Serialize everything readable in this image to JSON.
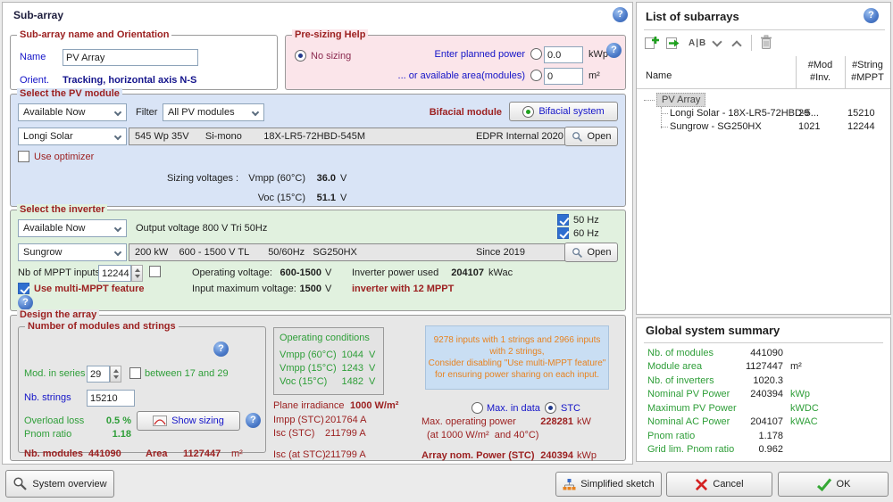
{
  "main": {
    "title": "Sub-array",
    "nameOrient": {
      "legend": "Sub-array name and Orientation",
      "nameLabel": "Name",
      "nameValue": "PV Array",
      "orientLabel": "Orient.",
      "orientValue": "Tracking, horizontal axis N-S"
    },
    "presizing": {
      "legend": "Pre-sizing Help",
      "noSizing": "No sizing",
      "plannedLabel": "Enter planned power",
      "plannedValue": "0.0",
      "plannedUnit": "kWp",
      "areaLabel": "... or available area(modules)",
      "areaValue": "0",
      "areaUnit": "m²"
    },
    "pv": {
      "legend": "Select the PV module",
      "availability": "Available Now",
      "filterLabel": "Filter",
      "filterValue": "All PV modules",
      "bifacialLabel": "Bifacial module",
      "bifacialButton": "Bifacial system",
      "manufacturer": "Longi Solar",
      "spec": "545 Wp 35V      Si-mono        18X-LR5-72HBD-545M",
      "source": "EDPR Internal 2020",
      "open": "Open",
      "useOptimizer": "Use optimizer",
      "sizingLabel": "Sizing voltages :",
      "vmppLabel": "Vmpp (60°C)",
      "vmppValue": "36.0",
      "vmppUnit": "V",
      "vocLabel": "Voc (15°C)",
      "vocValue": "51.1",
      "vocUnit": "V"
    },
    "inv": {
      "legend": "Select the inverter",
      "availability": "Available Now",
      "outputVoltage": "Output voltage 800 V Tri 50Hz",
      "hz50": "50 Hz",
      "hz60": "60 Hz",
      "manufacturer": "Sungrow",
      "spec": "200 kW    600 - 1500 V TL       50/60Hz   SG250HX",
      "since": "Since 2019",
      "open": "Open",
      "mpptLabel": "Nb of MPPT inputs",
      "mpptValue": "12244",
      "opVoltLabel": "Operating voltage:",
      "opVoltValue": "600-1500",
      "opVoltUnit": "V",
      "powerUsedLabel": "Inverter power used",
      "powerUsedValue": "204107",
      "powerUsedUnit": "kWac",
      "multiMppt": "Use multi-MPPT feature",
      "inputMaxLabel": "Input maximum voltage:",
      "inputMaxValue": "1500",
      "inputMaxUnit": "V",
      "mpptNote": "inverter with 12 MPPT"
    },
    "design": {
      "legend": "Design the array",
      "mods": {
        "legend": "Number of modules and strings",
        "modSeriesLabel": "Mod. in series",
        "modSeriesValue": "29",
        "betweenLabel": "between 17 and 29",
        "nbStringsLabel": "Nb. strings",
        "nbStringsValue": "15210",
        "overloadLabel": "Overload loss",
        "overloadValue": "0.5 %",
        "pnomLabel": "Pnom ratio",
        "pnomValue": "1.18",
        "showSizing": "Show sizing",
        "nbModulesLabel": "Nb. modules",
        "nbModulesValue": "441090",
        "areaLabel": "Area",
        "areaValue": "1127447",
        "areaUnit": "m²"
      },
      "operating": {
        "title": "Operating conditions",
        "rows": [
          {
            "label": "Vmpp (60°C)",
            "value": "1044",
            "unit": "V"
          },
          {
            "label": "Vmpp (15°C)",
            "value": "1243",
            "unit": "V"
          },
          {
            "label": "Voc (15°C)",
            "value": "1482",
            "unit": "V"
          }
        ]
      },
      "stc": {
        "planeLabel": "Plane irradiance",
        "planeValue": "1000 W/m²",
        "imppLabel": "Impp (STC)",
        "imppValue": "201764 A",
        "iscLabel": "Isc (STC)",
        "iscValue": "211799 A",
        "iscAtLabel": "Isc (at STC)",
        "iscAtValue": "211799 A"
      },
      "warning": [
        "9278 inputs with 1 strings and 2966 inputs",
        "with 2 strings,",
        "Consider disabling \"Use multi-MPPT feature\"",
        "for ensuring power sharing on each input."
      ],
      "maxInData": "Max. in data",
      "stcRadio": "STC",
      "maxPowerLabel": "Max. operating power",
      "maxPowerValue": "228281",
      "maxPowerUnit": "kW",
      "maxPowerNote": "(at 1000 W/m²  and 40°C)",
      "arrayPowerLabel": "Array nom. Power (STC)",
      "arrayPowerValue": "240394",
      "arrayPowerUnit": "kWp"
    },
    "footer": {
      "systemOverview": "System overview",
      "simplifiedSketch": "Simplified sketch",
      "cancel": "Cancel",
      "ok": "OK"
    }
  },
  "list": {
    "title": "List of subarrays",
    "renameIcon": "A|B",
    "headers": {
      "name": "Name",
      "mod": "#Mod",
      "inv": "#Inv.",
      "string": "#String",
      "mppt": "#MPPT"
    },
    "root": "PV Array",
    "rows": [
      {
        "name": "Longi Solar - 18X-LR5-72HBD-5...",
        "mod": "29",
        "string": "15210"
      },
      {
        "name": "Sungrow - SG250HX",
        "mod": "1021",
        "string": "12244"
      }
    ]
  },
  "summary": {
    "title": "Global system summary",
    "rows": [
      {
        "label": "Nb. of modules",
        "value": "441090",
        "unit": ""
      },
      {
        "label": "Module area",
        "value": "1127447",
        "unit": "m²"
      },
      {
        "label": "Nb. of inverters",
        "value": "1020.3",
        "unit": ""
      },
      {
        "label": "Nominal PV Power",
        "value": "240394",
        "unit": "kWp"
      },
      {
        "label": "Maximum PV Power",
        "value": "",
        "unit": "kWDC"
      },
      {
        "label": "Nominal AC Power",
        "value": "204107",
        "unit": "kWAC"
      },
      {
        "label": "Pnom ratio",
        "value": "1.178",
        "unit": ""
      },
      {
        "label": "Grid lim. Pnom ratio",
        "value": "0.962",
        "unit": ""
      }
    ]
  },
  "colors": {
    "accentMaroon": "#9c2121",
    "labelBlue": "#1414c8",
    "green": "#2e9e38",
    "warningOrange": "#e8821e",
    "helpBlue": "#4a79c8",
    "sectionPink": "#fbe5ea",
    "sectionBlue": "#d9e4f6",
    "sectionGreen": "#e1f1df",
    "sectionGray": "#e7e7e7"
  }
}
